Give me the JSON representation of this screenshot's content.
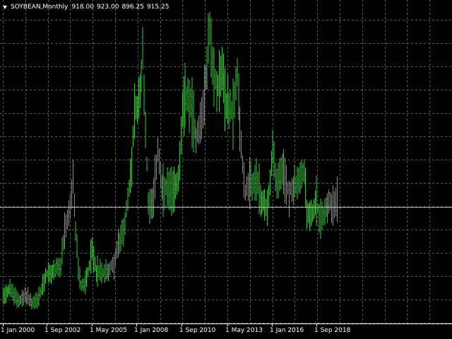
{
  "info": {
    "symbol": "SOYBEAN,Monthly",
    "open": "918.00",
    "high": "923.00",
    "low": "896.25",
    "close": "915.25"
  },
  "colors": {
    "background": "#000000",
    "bars": "#3fbf3f",
    "grid": "#5a5a5a",
    "foreground": "#ffffff",
    "price_line": "#b4b4b4"
  },
  "chart_data": {
    "type": "bar",
    "series": [
      {
        "values": []
      }
    ],
    "x_tick_labels": [
      "1 Jan 2000",
      "1 Sep 2002",
      "1 May 2005",
      "1 Jan 2008",
      "1 Sep 2010",
      "1 May 2013",
      "1 Jan 2016",
      "1 Sep 2018"
    ],
    "x_range": [
      "2000-01",
      "2020-05"
    ],
    "price_scale": "not shown",
    "grid": true,
    "current_price": 915.25,
    "price_series": [
      [
        "2000-01",
        480
      ],
      [
        "2000-06",
        510
      ],
      [
        "2000-09",
        470
      ],
      [
        "2001-02",
        455
      ],
      [
        "2001-06",
        475
      ],
      [
        "2001-10",
        440
      ],
      [
        "2002-02",
        450
      ],
      [
        "2002-06",
        520
      ],
      [
        "2002-09",
        575
      ],
      [
        "2002-12",
        570
      ],
      [
        "2003-04",
        610
      ],
      [
        "2003-07",
        600
      ],
      [
        "2003-10",
        760
      ],
      [
        "2004-02",
        880
      ],
      [
        "2004-04",
        1000
      ],
      [
        "2004-06",
        770
      ],
      [
        "2004-08",
        600
      ],
      [
        "2004-10",
        520
      ],
      [
        "2005-01",
        530
      ],
      [
        "2005-06",
        680
      ],
      [
        "2005-09",
        590
      ],
      [
        "2006-01",
        580
      ],
      [
        "2006-06",
        590
      ],
      [
        "2006-10",
        620
      ],
      [
        "2007-01",
        700
      ],
      [
        "2007-05",
        780
      ],
      [
        "2007-08",
        900
      ],
      [
        "2007-11",
        1080
      ],
      [
        "2008-01",
        1300
      ],
      [
        "2008-04",
        1350
      ],
      [
        "2008-07",
        1570
      ],
      [
        "2008-09",
        1250
      ],
      [
        "2008-11",
        900
      ],
      [
        "2009-03",
        920
      ],
      [
        "2009-06",
        1150
      ],
      [
        "2009-09",
        950
      ],
      [
        "2010-01",
        960
      ],
      [
        "2010-05",
        940
      ],
      [
        "2010-09",
        1020
      ],
      [
        "2010-12",
        1300
      ],
      [
        "2011-03",
        1390
      ],
      [
        "2011-06",
        1350
      ],
      [
        "2011-10",
        1200
      ],
      [
        "2012-02",
        1280
      ],
      [
        "2012-05",
        1450
      ],
      [
        "2012-08",
        1700
      ],
      [
        "2012-10",
        1500
      ],
      [
        "2013-01",
        1430
      ],
      [
        "2013-05",
        1500
      ],
      [
        "2013-08",
        1350
      ],
      [
        "2014-01",
        1310
      ],
      [
        "2014-04",
        1500
      ],
      [
        "2014-07",
        1150
      ],
      [
        "2014-10",
        950
      ],
      [
        "2015-02",
        980
      ],
      [
        "2015-06",
        1000
      ],
      [
        "2015-10",
        900
      ],
      [
        "2016-02",
        870
      ],
      [
        "2016-06",
        1150
      ],
      [
        "2016-09",
        980
      ],
      [
        "2017-01",
        1040
      ],
      [
        "2017-06",
        950
      ],
      [
        "2017-09",
        970
      ],
      [
        "2018-02",
        1000
      ],
      [
        "2018-05",
        1050
      ],
      [
        "2018-07",
        860
      ],
      [
        "2018-10",
        850
      ],
      [
        "2019-02",
        900
      ],
      [
        "2019-05",
        820
      ],
      [
        "2019-08",
        860
      ],
      [
        "2019-11",
        920
      ],
      [
        "2020-03",
        880
      ],
      [
        "2020-05",
        905
      ]
    ]
  }
}
